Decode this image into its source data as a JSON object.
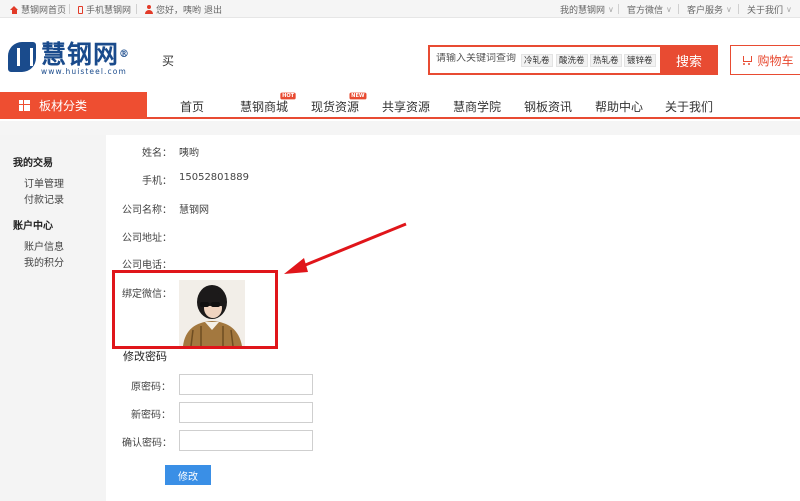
{
  "topbar": {
    "home_link": "慧钢网首页",
    "mobile_link": "手机慧钢网",
    "greeting": "您好，咦哟",
    "logout": "退出",
    "my_account": "我的慧钢网",
    "wechat": "官方微信",
    "service": "客户服务",
    "about": "关于我们"
  },
  "header": {
    "logo_name": "慧钢网",
    "logo_url": "www.huisteel.com",
    "tagline": "买",
    "search_placeholder": "请输入关键词查询",
    "hot_tags": [
      "冷轧卷",
      "酸洗卷",
      "热轧卷",
      "镀锌卷"
    ],
    "search_button": "搜索",
    "cart_button": "购物车"
  },
  "nav": {
    "category": "板材分类",
    "items": [
      "首页",
      "慧钢商城",
      "现货资源",
      "共享资源",
      "慧商学院",
      "钢板资讯",
      "帮助中心",
      "关于我们"
    ],
    "badges": {
      "mall": "HOT",
      "spot": "NEW"
    }
  },
  "sidebar": {
    "sections": [
      {
        "title": "我的交易",
        "links": [
          "订单管理",
          "付款记录"
        ]
      },
      {
        "title": "账户中心",
        "links": [
          "账户信息",
          "我的积分"
        ]
      }
    ]
  },
  "profile": {
    "name_label": "姓名：",
    "name_value": "咦哟",
    "phone_label": "手机：",
    "phone_value": "15052801889",
    "company_label": "公司名称：",
    "company_value": "慧钢网",
    "address_label": "公司地址：",
    "tel_label": "公司电话：",
    "wechat_label": "绑定微信："
  },
  "password": {
    "title": "修改密码",
    "old_label": "原密码：",
    "new_label": "新密码：",
    "confirm_label": "确认密码：",
    "submit": "修改"
  },
  "colors": {
    "brand_red": "#e84b32",
    "brand_blue": "#1a4b8c",
    "annotation_red": "#e0151a",
    "button_blue": "#3a8fe6"
  }
}
